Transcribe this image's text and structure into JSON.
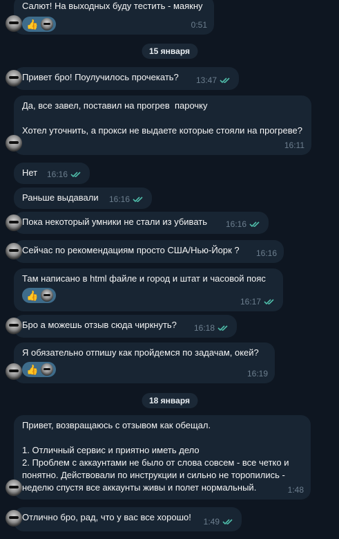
{
  "messages": {
    "m0": {
      "text": "Салют! На выходных буду тестить - маякну",
      "time": "0:51",
      "reaction": "👍"
    },
    "d1": "15 января",
    "m1": {
      "text": "Привет бро! Поулучилось прочекать?",
      "time": "13:47"
    },
    "m2": {
      "text": "Да, все завел, поставил на прогрев  парочку\n\nХотел уточнить, а прокси не выдаете которые стояли на прогреве?",
      "time": "16:11"
    },
    "m3": {
      "text": "Нет",
      "time": "16:16"
    },
    "m4": {
      "text": "Раньше выдавали",
      "time": "16:16"
    },
    "m5": {
      "text": "Пока некоторый умники не стали из убивать",
      "time": "16:16"
    },
    "m6": {
      "text": "Сейчас по рекомендациям просто США/Нью-Йорк ?",
      "time": "16:16"
    },
    "m7": {
      "text": "Там написано в html файле и город и штат и часовой пояс",
      "time": "16:17",
      "reaction": "👍"
    },
    "m8": {
      "text": "Бро а можешь отзыв сюда чиркнуть?",
      "time": "16:18"
    },
    "m9": {
      "text": "Я обязательно отпишу как пройдемся по задачам, окей?",
      "time": "16:19",
      "reaction": "👍"
    },
    "d2": "18 января",
    "m10": {
      "text": "Привет, возвращаюсь с отзывом как обещал.\n\n1. Отличный сервис и приятно иметь дело\n2. Проблем с аккаунтами не было от слова совсем - все четко и понятно. Действовали по инструкции и сильно не торопились - неделю спустя все аккаунты живы и полет нормальный.",
      "time": "1:48"
    },
    "m11": {
      "text": "Отлично бро, рад, что у вас все хорошо!",
      "time": "1:49"
    }
  },
  "colors": {
    "background": "#0e1621",
    "bubble": "#182533",
    "meta": "#6d7f8f",
    "check": "#4fbdaa",
    "reaction": "#3e6c8b"
  }
}
